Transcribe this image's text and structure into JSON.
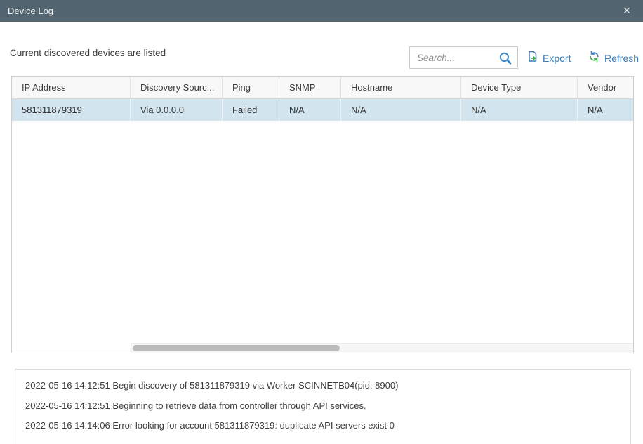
{
  "window": {
    "title": "Device Log",
    "close_icon": "×"
  },
  "toolbar": {
    "subtitle": "Current discovered devices are listed",
    "search": {
      "placeholder": "Search...",
      "value": ""
    },
    "export_label": "Export",
    "refresh_label": "Refresh",
    "icons": [
      "search-icon",
      "export-icon",
      "refresh-icon"
    ]
  },
  "table": {
    "columns": [
      "IP Address",
      "Discovery Sourc...",
      "Ping",
      "SNMP",
      "Hostname",
      "Device Type",
      "Vendor"
    ],
    "rows": [
      {
        "ip": "581311879319",
        "discovery_source": "Via 0.0.0.0",
        "ping": "Failed",
        "snmp": "N/A",
        "hostname": "N/A",
        "device_type": "N/A",
        "vendor": "N/A",
        "selected": true
      }
    ]
  },
  "log": {
    "lines": [
      "2022-05-16 14:12:51 Begin discovery of 581311879319 via Worker SCINNETB04(pid: 8900)",
      "2022-05-16 14:12:51 Beginning to retrieve data from controller through API services.",
      "2022-05-16 14:14:06 Error looking for account 581311879319: duplicate API servers exist 0"
    ]
  },
  "colors": {
    "titlebar_bg": "#536571",
    "link_blue": "#3c7cb4",
    "icon_blue": "#3e86c6",
    "icon_green": "#41a94e",
    "selected_row_bg": "#d2e4ee",
    "header_bg": "#f8f8f8"
  }
}
